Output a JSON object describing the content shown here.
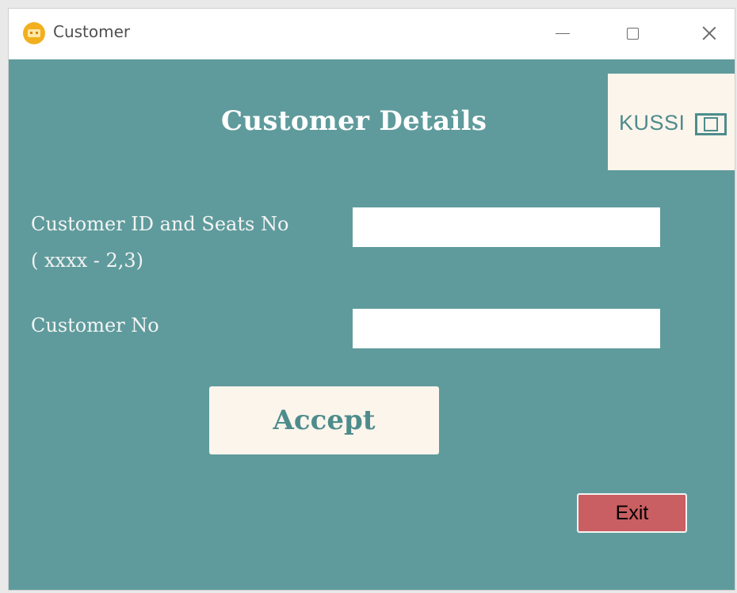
{
  "window": {
    "title": "Customer",
    "icon": "app-icon",
    "controls": {
      "minimize": "minimize-icon",
      "maximize": "maximize-icon",
      "close": "close-icon"
    }
  },
  "form": {
    "heading": "Customer Details",
    "logo_text": "KUSSI",
    "logo_icon": "film-frame-icon",
    "fields": {
      "customer_id": {
        "label": "Customer ID and Seats No",
        "hint": "( xxxx - 2,3)",
        "value": "",
        "placeholder": ""
      },
      "customer_no": {
        "label": "Customer No",
        "value": "",
        "placeholder": ""
      }
    },
    "accept_label": "Accept",
    "exit_label": "Exit"
  },
  "colors": {
    "background": "#5f9b9c",
    "panel": "#fcf5ec",
    "accent_text": "#4e8c8c",
    "exit_button": "#c95f62"
  }
}
